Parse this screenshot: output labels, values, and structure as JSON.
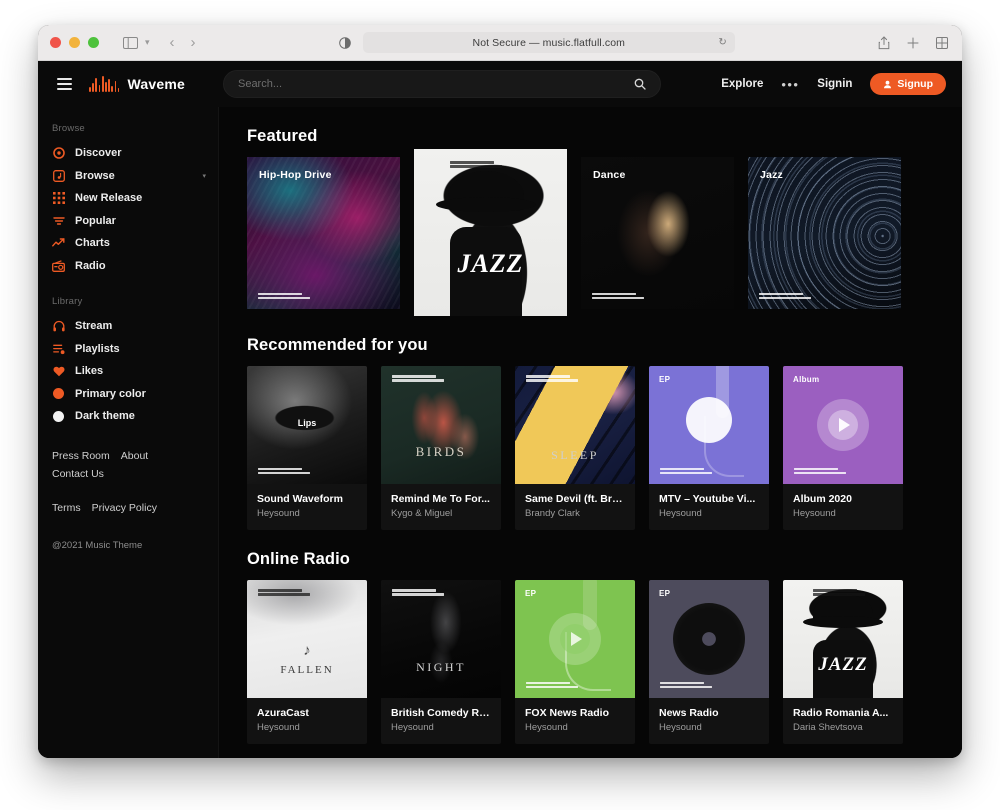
{
  "browser": {
    "url_text": "Not Secure — music.flatfull.com",
    "icons": {
      "sidebar": "sidebar-icon",
      "chevron": "chevron-down-icon",
      "back": "‹",
      "forward": "›",
      "reader": "reader-mode-icon",
      "reload": "↻",
      "share": "share-icon",
      "newtab": "+",
      "tabs": "tab-overview-icon"
    }
  },
  "header": {
    "brand": "Waveme",
    "search_placeholder": "Search...",
    "search_value": "",
    "explore_label": "Explore",
    "more_label": "•••",
    "signin_label": "Signin",
    "signup_label": "Signup",
    "accent_color": "#ee5a24"
  },
  "sidebar": {
    "browse_heading": "Browse",
    "browse_items": [
      {
        "label": "Discover",
        "icon": "record-icon"
      },
      {
        "label": "Browse",
        "icon": "music-box-icon",
        "caret": "▾"
      },
      {
        "label": "New Release",
        "icon": "grid-icon"
      },
      {
        "label": "Popular",
        "icon": "funnel-icon"
      },
      {
        "label": "Charts",
        "icon": "trending-up-icon"
      },
      {
        "label": "Radio",
        "icon": "radio-icon"
      }
    ],
    "library_heading": "Library",
    "library_items": [
      {
        "label": "Stream",
        "icon": "headphones-icon"
      },
      {
        "label": "Playlists",
        "icon": "playlist-icon"
      },
      {
        "label": "Likes",
        "icon": "heart-icon"
      },
      {
        "label": "Primary color",
        "icon": "color-swatch-icon"
      },
      {
        "label": "Dark theme",
        "icon": "theme-swatch-icon"
      }
    ],
    "links_group_1": [
      "Press Room",
      "About",
      "Contact Us"
    ],
    "links_group_2": [
      "Terms",
      "Privacy Policy"
    ],
    "copyright": "@2021 Music Theme"
  },
  "sections": {
    "featured": {
      "title": "Featured",
      "cards": [
        {
          "title": "Hip-Hop Drive",
          "art": "art-hiphop"
        },
        {
          "title": "",
          "art": "art-jazzman"
        },
        {
          "title": "Dance",
          "art": "art-dance"
        },
        {
          "title": "Jazz",
          "art": "art-jazzsky"
        }
      ]
    },
    "recommended": {
      "title": "Recommended for you",
      "cards": [
        {
          "title": "Sound Waveform",
          "artist": "Heysound",
          "badge": "",
          "art_label": "Lips",
          "art": "art-lips"
        },
        {
          "title": "Remind Me To For...",
          "artist": "Kygo & Miguel",
          "badge": "",
          "art_label": "BIRDS",
          "art": "art-birds"
        },
        {
          "title": "Same Devil (ft. Bra...",
          "artist": "Brandy Clark",
          "badge": "",
          "art_label": "SLEEP",
          "art": "art-sleep"
        },
        {
          "title": "MTV – Youtube Vi...",
          "artist": "Heysound",
          "badge": "EP",
          "art_label": "",
          "art": "art-mtv"
        },
        {
          "title": "Album 2020",
          "artist": "Heysound",
          "badge": "Album",
          "art_label": "",
          "art": "art-album"
        }
      ]
    },
    "radio": {
      "title": "Online Radio",
      "cards": [
        {
          "title": "AzuraCast",
          "artist": "Heysound",
          "badge": "",
          "art_label": "FALLEN",
          "art": "art-fallen"
        },
        {
          "title": "British Comedy Ra...",
          "artist": "Heysound",
          "badge": "",
          "art_label": "NIGHT",
          "art": "art-night"
        },
        {
          "title": "FOX News Radio",
          "artist": "Heysound",
          "badge": "EP",
          "art_label": "",
          "art": "art-fox"
        },
        {
          "title": "News Radio",
          "artist": "Heysound",
          "badge": "EP",
          "art_label": "",
          "art": "art-news"
        },
        {
          "title": "Radio Romania A...",
          "artist": "Daria Shevtsova",
          "badge": "",
          "art_label": "JAZZ",
          "art": "art-jazzman2"
        }
      ]
    }
  }
}
